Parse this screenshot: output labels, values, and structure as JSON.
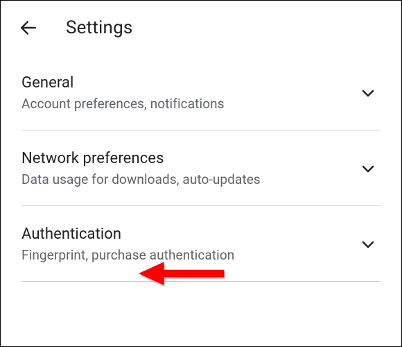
{
  "header": {
    "title": "Settings"
  },
  "items": [
    {
      "title": "General",
      "subtitle": "Account preferences, notifications"
    },
    {
      "title": "Network preferences",
      "subtitle": "Data usage for downloads, auto-updates"
    },
    {
      "title": "Authentication",
      "subtitle": "Fingerprint, purchase authentication"
    }
  ]
}
